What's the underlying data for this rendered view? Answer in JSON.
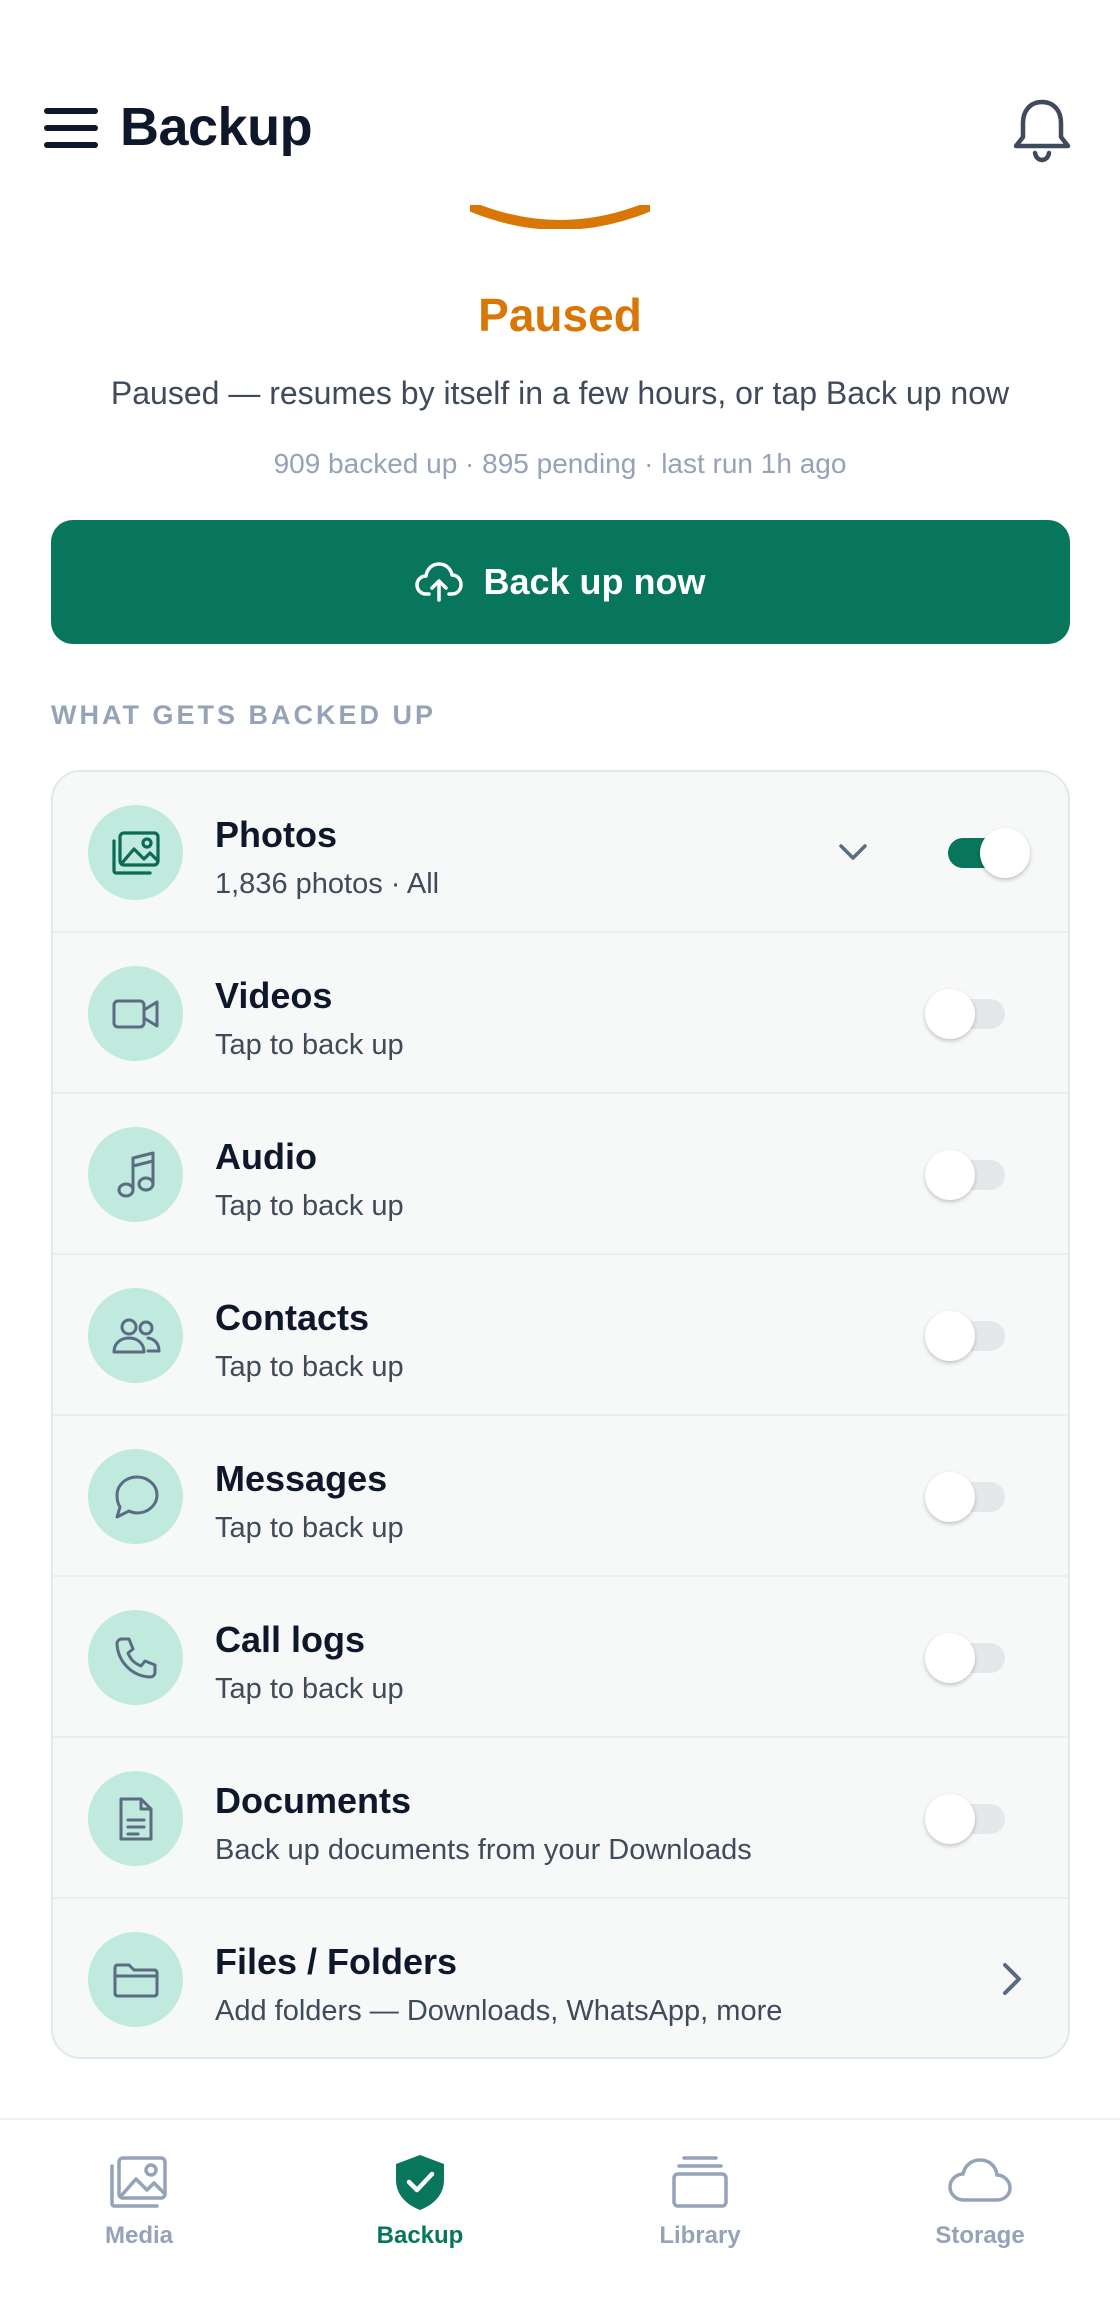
{
  "header": {
    "title": "Backup",
    "menu_icon": "hamburger-menu-icon",
    "notification_icon": "bell-icon"
  },
  "status": {
    "title": "Paused",
    "message": "Paused — resumes by itself in a few hours, or tap Back up now",
    "stats": "909 backed up · 895 pending · last run 1h ago",
    "color": "#d97706"
  },
  "backup_button": {
    "label": "Back up now",
    "icon": "cloud-upload-icon",
    "color": "#08765c"
  },
  "section": {
    "title": "WHAT GETS BACKED UP"
  },
  "categories": [
    {
      "title": "Photos",
      "subtitle": "1,836 photos · All",
      "icon": "photos-icon",
      "enabled": true,
      "expandable": true
    },
    {
      "title": "Videos",
      "subtitle": "Tap to back up",
      "icon": "video-camera-icon",
      "enabled": false
    },
    {
      "title": "Audio",
      "subtitle": "Tap to back up",
      "icon": "music-note-icon",
      "enabled": false
    },
    {
      "title": "Contacts",
      "subtitle": "Tap to back up",
      "icon": "contacts-icon",
      "enabled": false
    },
    {
      "title": "Messages",
      "subtitle": "Tap to back up",
      "icon": "message-bubble-icon",
      "enabled": false
    },
    {
      "title": "Call logs",
      "subtitle": "Tap to back up",
      "icon": "phone-icon",
      "enabled": false
    },
    {
      "title": "Documents",
      "subtitle": "Back up documents from your Downloads",
      "icon": "document-icon",
      "enabled": false
    },
    {
      "title": "Files / Folders",
      "subtitle": "Add folders — Downloads, WhatsApp, more",
      "icon": "folder-icon",
      "navigates": true
    }
  ],
  "bottom_nav": [
    {
      "label": "Media",
      "icon": "media-icon",
      "active": false
    },
    {
      "label": "Backup",
      "icon": "shield-check-icon",
      "active": true
    },
    {
      "label": "Library",
      "icon": "library-icon",
      "active": false
    },
    {
      "label": "Storage",
      "icon": "cloud-icon",
      "active": false
    }
  ]
}
